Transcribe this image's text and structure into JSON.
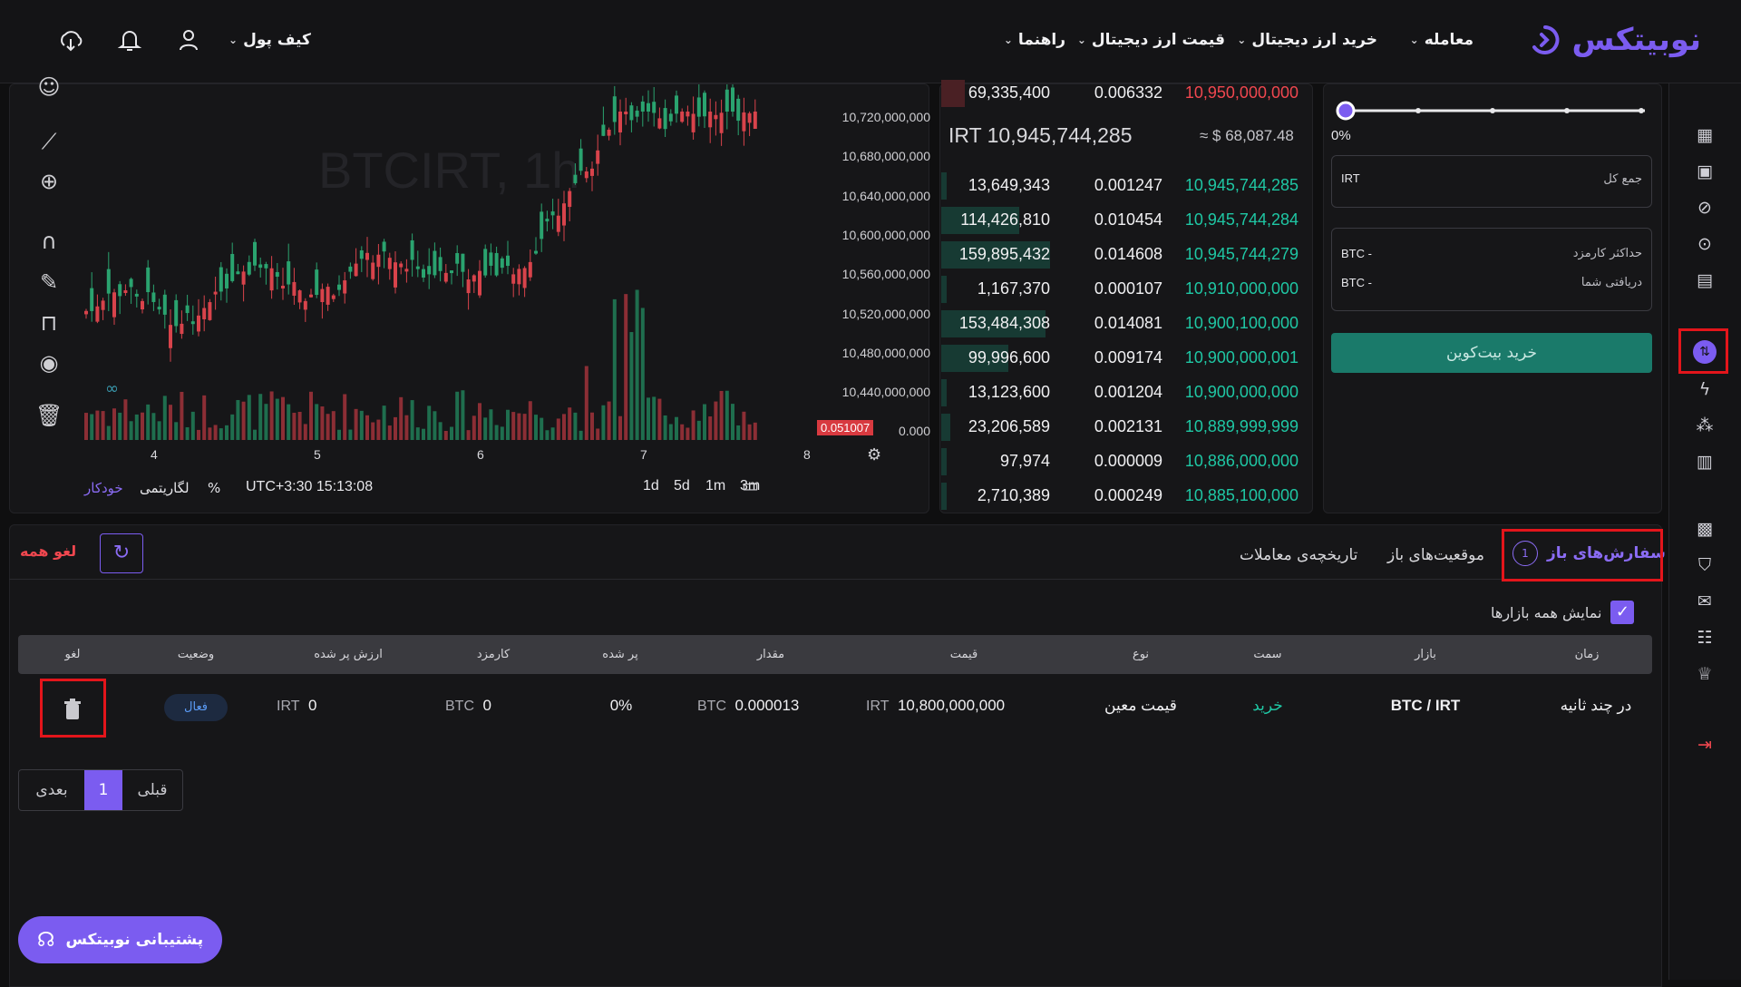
{
  "nav": {
    "logo": "نوبیتکس",
    "items": [
      "معامله",
      "خرید ارز دیجیتال",
      "قیمت ارز دیجیتال",
      "راهنما",
      "کیف پول"
    ]
  },
  "chart": {
    "watermark_symbol": "BTCIRT, 1h",
    "y_ticks": [
      "10,720,000,000",
      "10,680,000,000",
      "10,640,000,000",
      "10,600,000,000",
      "10,560,000,000",
      "10,520,000,000",
      "10,480,000,000",
      "10,440,000,000",
      "0.000"
    ],
    "x_ticks": [
      "4",
      "5",
      "6",
      "7",
      "8"
    ],
    "volume_badge": "0.051007",
    "timezone_time": "UTC+3:30 15:13:08",
    "percent_label": "%",
    "log_label": "لگاریتمی",
    "auto_label": "خودکار",
    "ranges": [
      "3m",
      "1m",
      "5d",
      "1d"
    ]
  },
  "orderbook": {
    "top_row": {
      "total": "69,335,400",
      "amount": "0.006332",
      "price": "10,950,000,000"
    },
    "last_price": "IRT 10,945,744,285",
    "usd_price": "≈ $ 68,087.48",
    "bids": [
      {
        "total": "13,649,343",
        "amount": "0.001247",
        "price": "10,945,744,285",
        "depth": 0.02
      },
      {
        "total": "114,426,810",
        "amount": "0.010454",
        "price": "10,945,744,284",
        "depth": 0.72
      },
      {
        "total": "159,895,432",
        "amount": "0.014608",
        "price": "10,945,744,279",
        "depth": 1.0
      },
      {
        "total": "1,167,370",
        "amount": "0.000107",
        "price": "10,910,000,000",
        "depth": 0.0
      },
      {
        "total": "153,484,308",
        "amount": "0.014081",
        "price": "10,900,100,000",
        "depth": 0.96
      },
      {
        "total": "99,996,600",
        "amount": "0.009174",
        "price": "10,900,000,001",
        "depth": 0.62
      },
      {
        "total": "13,123,600",
        "amount": "0.001204",
        "price": "10,900,000,000",
        "depth": 0.02
      },
      {
        "total": "23,206,589",
        "amount": "0.002131",
        "price": "10,889,999,999",
        "depth": 0.08
      },
      {
        "total": "97,974",
        "amount": "0.000009",
        "price": "10,886,000,000",
        "depth": 0.0
      },
      {
        "total": "2,710,389",
        "amount": "0.000249",
        "price": "10,885,100,000",
        "depth": 0.0
      }
    ]
  },
  "buy_panel": {
    "slider_percent": "0%",
    "total_label": "جمع کل",
    "total_unit": "IRT",
    "max_fee_label": "حداکثر کارمزد",
    "max_fee_value": "BTC  -",
    "receive_label": "دریافتی شما",
    "receive_value": "BTC  -",
    "buy_button": "خرید بیت‌کوین"
  },
  "orders": {
    "tabs": [
      "سفارش‌های باز",
      "موقعیت‌های باز",
      "تاریخچه‌ی معاملات"
    ],
    "open_count": "1",
    "cancel_all": "لغو همه",
    "show_all_markets": "نمایش همه بازارها",
    "headers": [
      "زمان",
      "بازار",
      "سمت",
      "نوع",
      "قیمت",
      "مقدار",
      "پر شده",
      "کارمزد",
      "ارزش پر شده",
      "وضعیت",
      "لغو"
    ],
    "row": {
      "time": "در چند ثانیه",
      "market": "BTC / IRT",
      "side": "خرید",
      "type": "قیمت معین",
      "price": "10,800,000,000",
      "price_unit": "IRT",
      "amount": "0.000013",
      "amount_unit": "BTC",
      "filled": "0%",
      "fee": "0",
      "fee_unit": "BTC",
      "filled_value": "0",
      "filled_value_unit": "IRT",
      "status": "فعال"
    },
    "pagination": {
      "prev": "قبلی",
      "page": "1",
      "next": "بعدی"
    }
  },
  "support_button": "پشتیبانی نوبیتکس",
  "colors": {
    "accent": "#7b5cf0",
    "buy": "#1fc7a4",
    "sell": "#f0474f",
    "highlight": "#e3151b"
  }
}
